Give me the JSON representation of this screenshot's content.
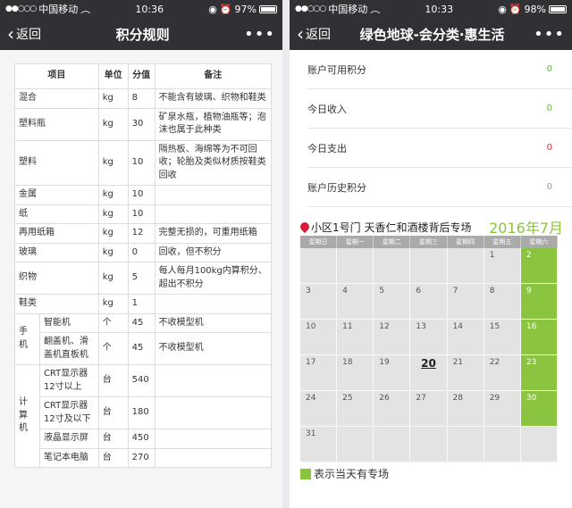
{
  "left": {
    "status": {
      "signal": "●●○○○",
      "carrier": "中国移动",
      "time": "10:36",
      "battery": "97%",
      "battery_level": 0.97
    },
    "nav": {
      "back": "返回",
      "title": "积分规则",
      "more": "•••"
    },
    "table": {
      "headers": [
        "项目",
        "单位",
        "分值",
        "备注"
      ],
      "rows": [
        {
          "item": "混合",
          "unit": "kg",
          "score": "8",
          "note": "不能含有玻璃、织物和鞋类"
        },
        {
          "item": "塑料瓶",
          "unit": "kg",
          "score": "30",
          "note": "矿泉水瓶，植物油瓶等；泡沫也属于此种类"
        },
        {
          "item": "塑料",
          "unit": "kg",
          "score": "10",
          "note": "隔热板、海绵等为不可回收；轮胎及类似材质按鞋类回收"
        },
        {
          "item": "金属",
          "unit": "kg",
          "score": "10",
          "note": ""
        },
        {
          "item": "纸",
          "unit": "kg",
          "score": "10",
          "note": ""
        },
        {
          "item": "再用纸箱",
          "unit": "kg",
          "score": "12",
          "note": "完整无损的，可重用纸箱"
        },
        {
          "item": "玻璃",
          "unit": "kg",
          "score": "0",
          "note": "回收，但不积分"
        },
        {
          "item": "织物",
          "unit": "kg",
          "score": "5",
          "note": "每人每月100kg内算积分、超出不积分"
        },
        {
          "item": "鞋类",
          "unit": "kg",
          "score": "1",
          "note": ""
        }
      ],
      "group_phone": {
        "label": "手机",
        "rows": [
          {
            "item": "智能机",
            "unit": "个",
            "score": "45",
            "note": "不收模型机"
          },
          {
            "item": "翻盖机、滑盖机直板机",
            "unit": "个",
            "score": "45",
            "note": "不收模型机"
          }
        ]
      },
      "group_computer": {
        "label": "计算机",
        "rows": [
          {
            "item": "CRT显示器12寸以上",
            "unit": "台",
            "score": "540",
            "note": ""
          },
          {
            "item": "CRT显示器12寸及以下",
            "unit": "台",
            "score": "180",
            "note": ""
          },
          {
            "item": "液晶显示屏",
            "unit": "台",
            "score": "450",
            "note": ""
          },
          {
            "item": "笔记本电脑",
            "unit": "台",
            "score": "270",
            "note": ""
          }
        ]
      }
    }
  },
  "right": {
    "status": {
      "signal": "●●○○○",
      "carrier": "中国移动",
      "time": "10:33",
      "battery": "98%",
      "battery_level": 0.98
    },
    "nav": {
      "back": "返回",
      "title": "绿色地球-会分类·惠生活",
      "more": "•••"
    },
    "account": [
      {
        "label": "账户可用积分",
        "value": "0",
        "color": "#5cb82a"
      },
      {
        "label": "今日收入",
        "value": "0",
        "color": "#5cb82a"
      },
      {
        "label": "今日支出",
        "value": "0",
        "color": "#d12b2b"
      },
      {
        "label": "账户历史积分",
        "value": "0",
        "color": "#999999"
      }
    ],
    "location": "小区1号门 天香仁和酒楼背后专场",
    "month": "2016年7月",
    "weekdays": [
      "星期日",
      "星期一",
      "星期二",
      "星期三",
      "星期四",
      "星期五",
      "星期六"
    ],
    "calendar": {
      "leading_blanks": 5,
      "days_in_month": 31,
      "today": 20,
      "highlight_days": [
        2,
        9,
        16,
        23,
        30
      ],
      "highlight_color": "#8bc53f"
    },
    "legend": "表示当天有专场"
  }
}
